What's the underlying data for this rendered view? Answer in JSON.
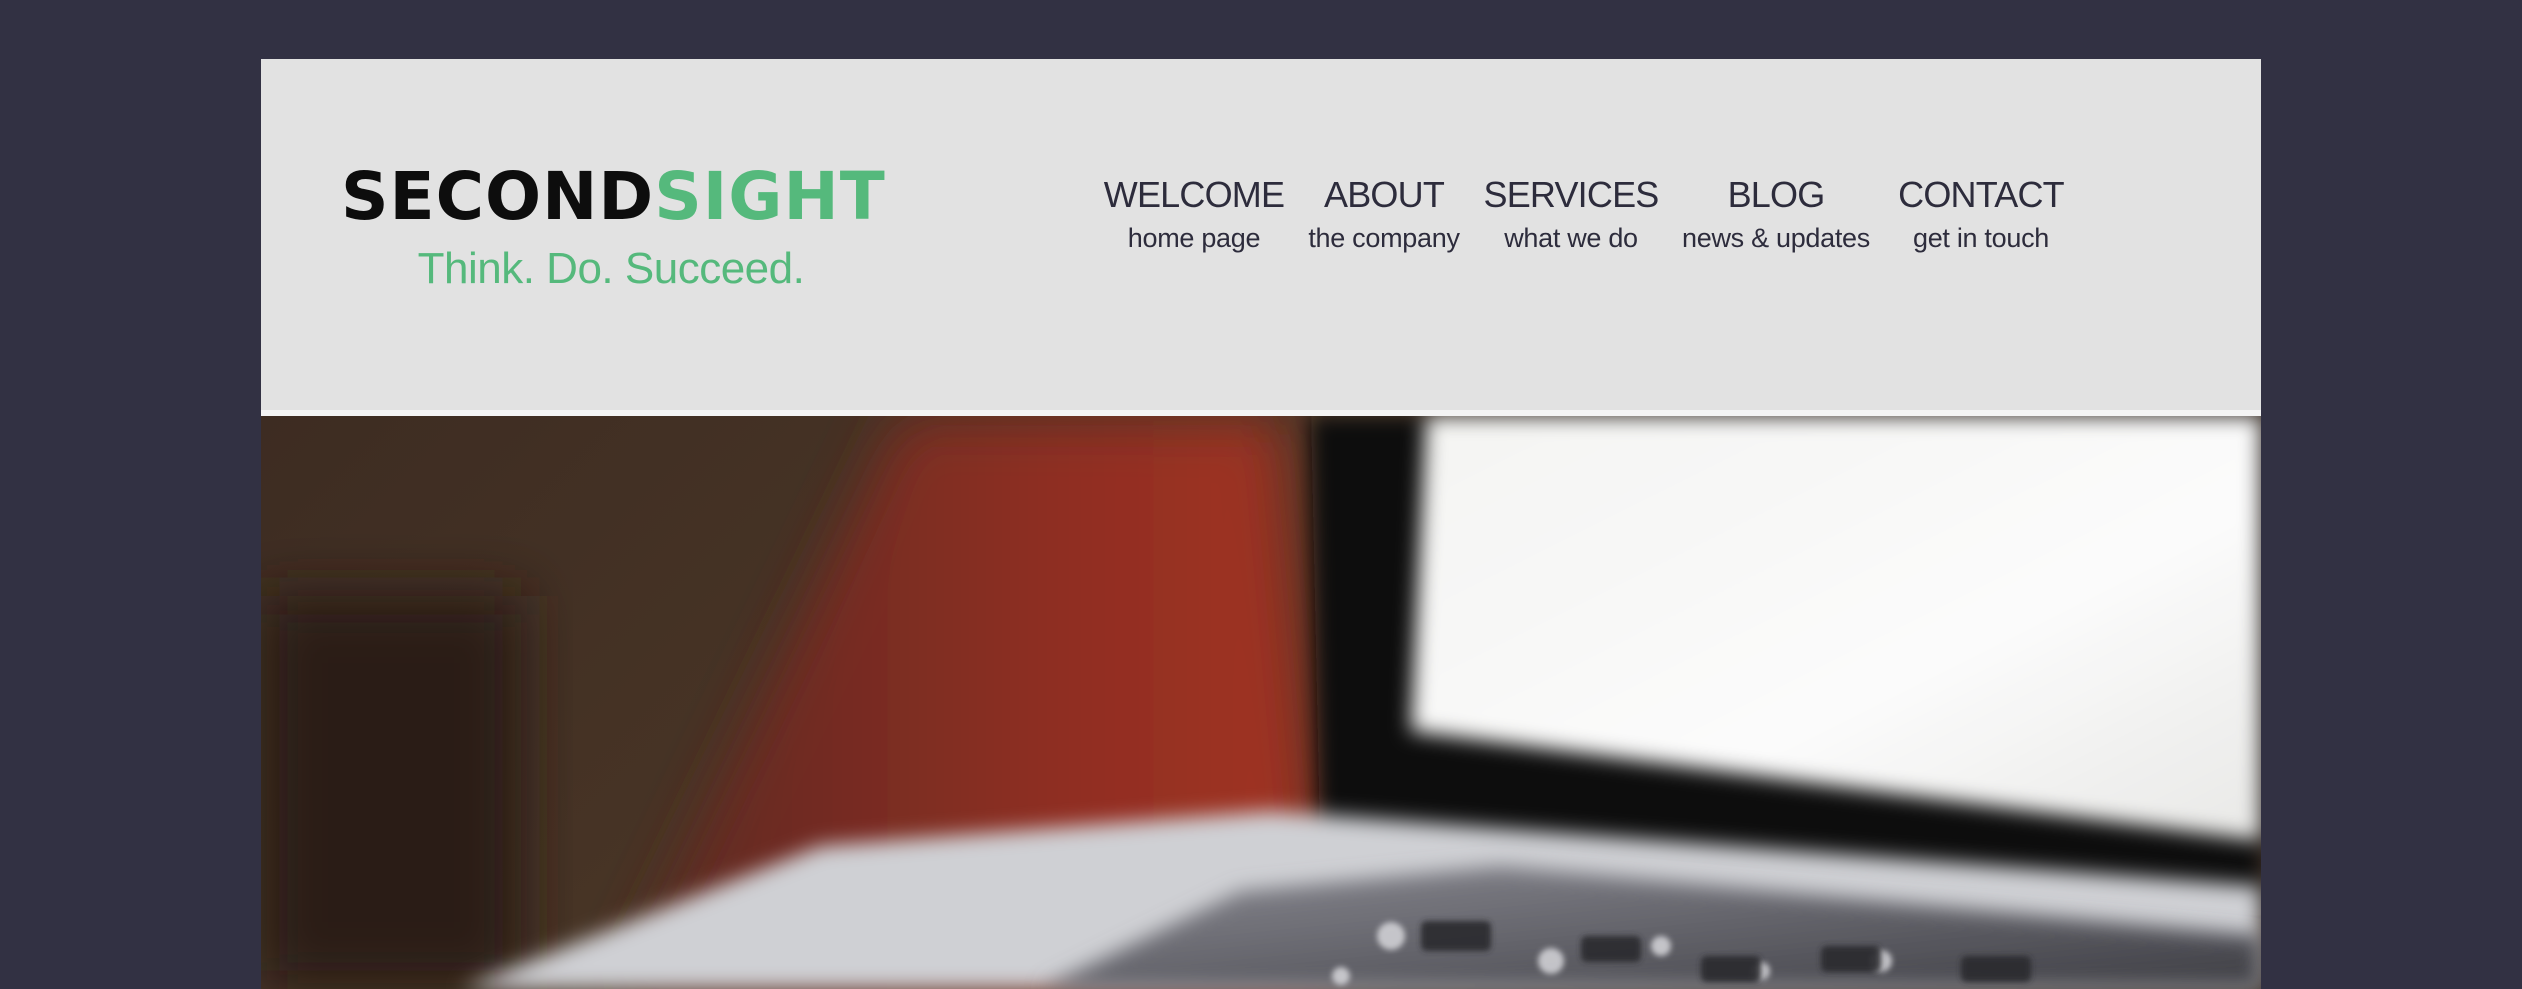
{
  "logo": {
    "brand_first": "SECOND",
    "brand_second": "SIGHT",
    "tagline": "Think. Do. Succeed."
  },
  "nav": [
    {
      "label": "WELCOME",
      "sub": "home page"
    },
    {
      "label": "ABOUT",
      "sub": "the company"
    },
    {
      "label": "SERVICES",
      "sub": "what we do"
    },
    {
      "label": "BLOG",
      "sub": "news & updates"
    },
    {
      "label": "CONTACT",
      "sub": "get in touch"
    }
  ],
  "hero": {
    "image": "laptop-photo"
  },
  "colors": {
    "page_background": "#323143",
    "header_background": "#e2e2e2",
    "brand_dark": "#0d0d0d",
    "brand_accent": "#55b97c",
    "nav_text": "#2d2c3c"
  }
}
